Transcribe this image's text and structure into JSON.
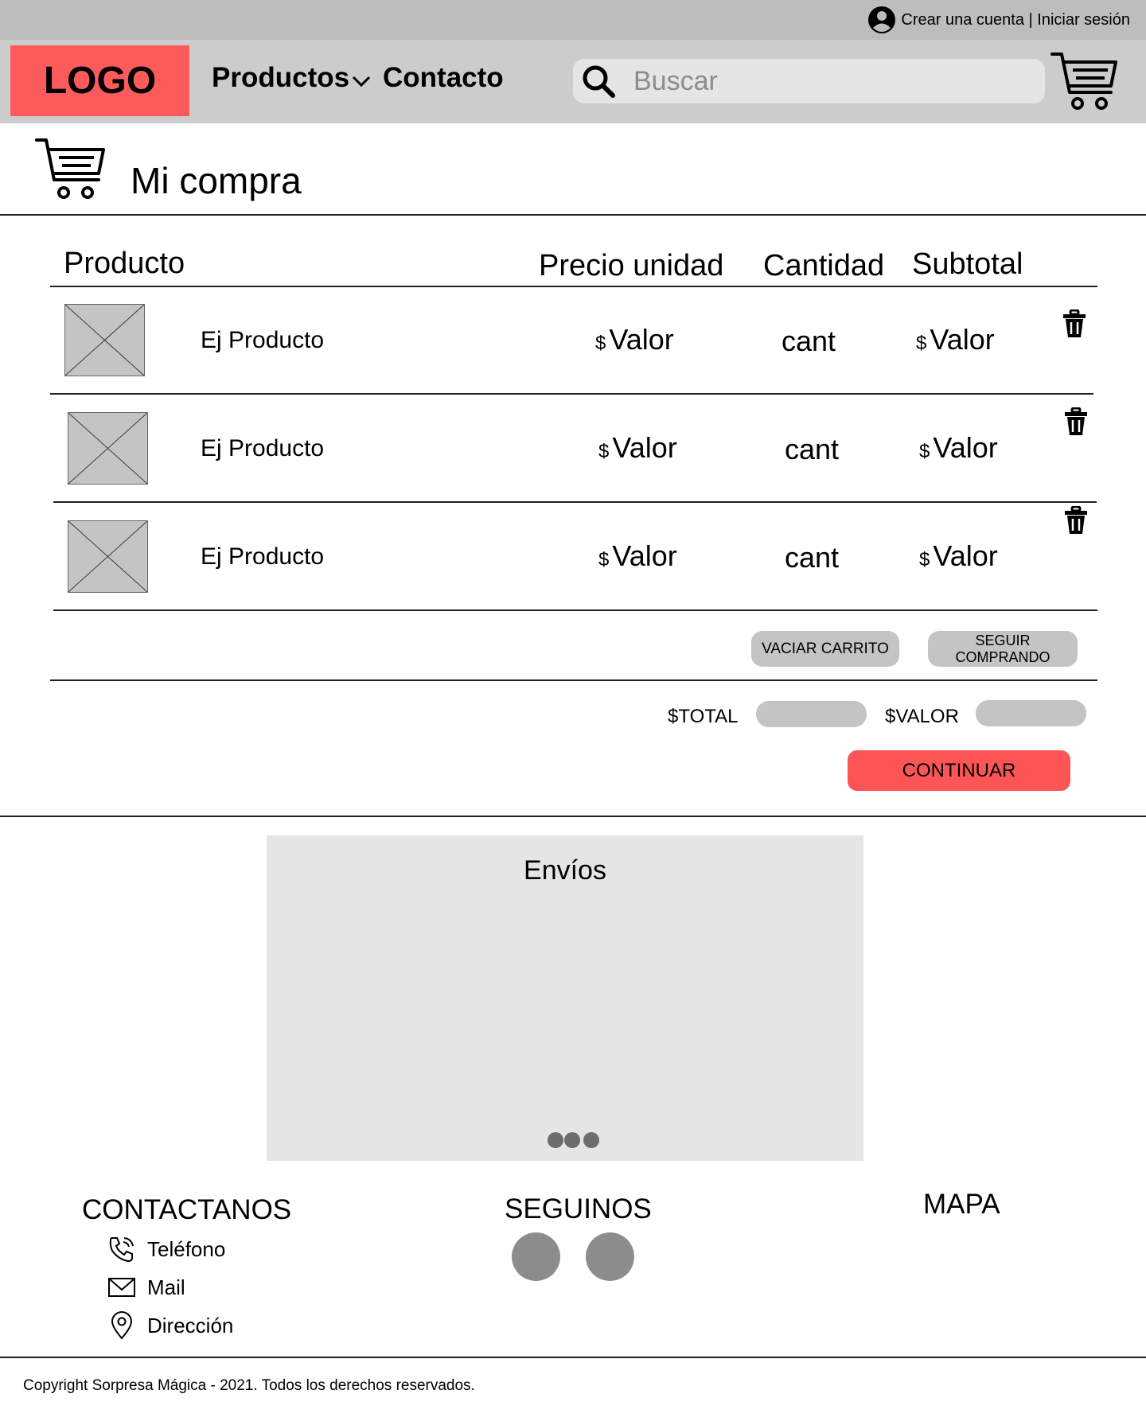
{
  "topbar": {
    "account_text": "Crear una cuenta | Iniciar sesión"
  },
  "header": {
    "logo": "LOGO",
    "nav": {
      "products": "Productos",
      "contact": "Contacto"
    },
    "search_placeholder": "Buscar"
  },
  "page": {
    "title": "Mi compra"
  },
  "table": {
    "headers": {
      "product": "Producto",
      "unit_price": "Precio unidad",
      "quantity": "Cantidad",
      "subtotal": "Subtotal"
    },
    "rows": [
      {
        "name": "Ej Producto",
        "currency": "$",
        "price": "Valor",
        "qty": "cant",
        "subtotal": "Valor"
      },
      {
        "name": "Ej Producto",
        "currency": "$",
        "price": "Valor",
        "qty": "cant",
        "subtotal": "Valor"
      },
      {
        "name": "Ej Producto",
        "currency": "$",
        "price": "Valor",
        "qty": "cant",
        "subtotal": "Valor"
      }
    ]
  },
  "actions": {
    "empty_cart": "VACIAR CARRITO",
    "keep_shopping": "SEGUIR COMPRANDO"
  },
  "totals": {
    "total_label": "$TOTAL",
    "value_label": "$VALOR",
    "continue": "CONTINUAR"
  },
  "carousel": {
    "title": "Envíos"
  },
  "footer": {
    "contact_title": "CONTACTANOS",
    "contact_items": {
      "phone": "Teléfono",
      "mail": "Mail",
      "address": "Dirección"
    },
    "social_title": "SEGUINOS",
    "map_title": "MAPA",
    "copyright": "Copyright Sorpresa Mágica - 2021. Todos los derechos reservados."
  },
  "colors": {
    "brand_red": "#fd5b5b",
    "header_gray": "#cccccc",
    "topbar_gray": "#bdbdbd",
    "field_gray": "#c4c4c4"
  }
}
